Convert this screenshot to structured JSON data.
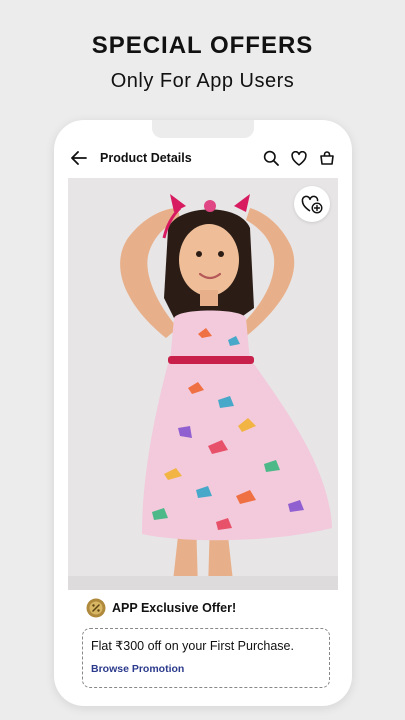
{
  "promo": {
    "title": "SPECIAL OFFERS",
    "subtitle": "Only For App Users"
  },
  "appbar": {
    "title": "Product Details",
    "icons": [
      "back-arrow-icon",
      "search-icon",
      "heart-icon",
      "bag-icon"
    ]
  },
  "product": {
    "image": "girl-in-pink-dinosaur-print-dress",
    "wishlist_icon": "heart-plus-icon"
  },
  "offer": {
    "badge_icon": "offer-badge-icon",
    "title": "APP Exclusive Offer!",
    "text": "Flat ₹300 off on your First Purchase.",
    "link": "Browse Promotion"
  },
  "colors": {
    "background": "#ececec",
    "dress_pink": "#f3c9dc",
    "ribbon_red": "#c8204a",
    "link_blue": "#2b3a8c",
    "badge_gold": "#b08a3c"
  }
}
